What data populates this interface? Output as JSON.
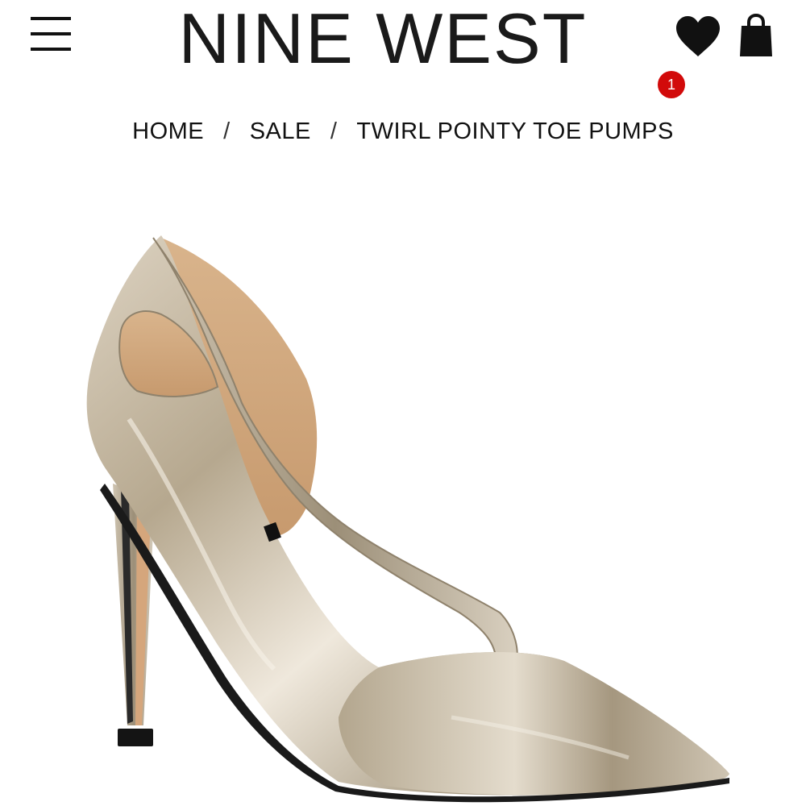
{
  "header": {
    "brand": "NINE WEST",
    "menu_icon": "hamburger-menu-icon",
    "wishlist_icon": "heart-icon",
    "cart_icon": "shopping-bag-icon",
    "cart_count": "1",
    "badge_color": "#d20a0a"
  },
  "breadcrumb": {
    "items": [
      "HOME",
      "SALE",
      "TWIRL POINTY TOE PUMPS"
    ],
    "separator": "/"
  },
  "product": {
    "image_icon": "metallic-pump-shoe-image",
    "colors": {
      "metallic": "#bcae98",
      "lining": "#d9b48c",
      "sole": "#141414"
    }
  }
}
